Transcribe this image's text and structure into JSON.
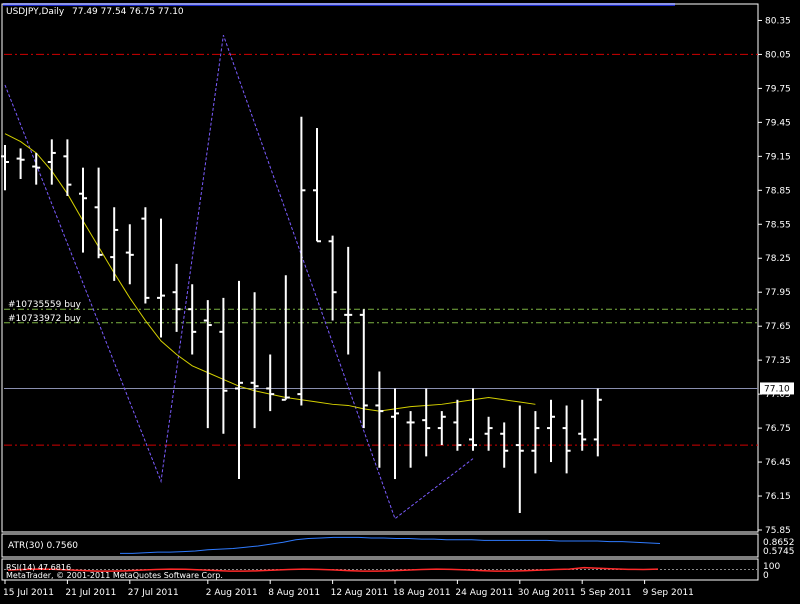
{
  "chart_data": {
    "type": "ohlc",
    "header": {
      "symbol_tf": "USDJPY,Daily",
      "ohlc_text": "77.49 77.54 76.75 77.10"
    },
    "price_axis": {
      "min": 75.85,
      "max": 80.46,
      "ticks": [
        "80.35",
        "80.05",
        "79.75",
        "79.45",
        "79.15",
        "78.85",
        "78.55",
        "78.25",
        "77.95",
        "77.65",
        "77.35",
        "77.05",
        "76.75",
        "76.45",
        "76.15",
        "75.85"
      ],
      "current_price": "77.10",
      "grid": false
    },
    "date_ticks": [
      {
        "label": "15 Jul 2011",
        "index": 0
      },
      {
        "label": "21 Jul 2011",
        "index": 4
      },
      {
        "label": "27 Jul 2011",
        "index": 8
      },
      {
        "label": "2 Aug 2011",
        "index": 13
      },
      {
        "label": "8 Aug 2011",
        "index": 17
      },
      {
        "label": "12 Aug 2011",
        "index": 21
      },
      {
        "label": "18 Aug 2011",
        "index": 25
      },
      {
        "label": "24 Aug 2011",
        "index": 29
      },
      {
        "label": "30 Aug 2011",
        "index": 33
      },
      {
        "label": "5 Sep 2011",
        "index": 37
      },
      {
        "label": "9 Sep 2011",
        "index": 41
      }
    ],
    "bars": [
      {
        "o": 79.15,
        "h": 79.25,
        "l": 78.85,
        "c": 79.1
      },
      {
        "o": 79.13,
        "h": 79.22,
        "l": 78.95,
        "c": 79.12
      },
      {
        "o": 79.06,
        "h": 79.18,
        "l": 78.9,
        "c": 79.05
      },
      {
        "o": 79.1,
        "h": 79.3,
        "l": 78.9,
        "c": 79.18
      },
      {
        "o": 79.15,
        "h": 79.3,
        "l": 78.8,
        "c": 78.9
      },
      {
        "o": 78.82,
        "h": 79.05,
        "l": 78.3,
        "c": 78.78
      },
      {
        "o": 78.7,
        "h": 79.05,
        "l": 78.25,
        "c": 78.28
      },
      {
        "o": 78.26,
        "h": 78.7,
        "l": 78.05,
        "c": 78.5
      },
      {
        "o": 78.3,
        "h": 78.55,
        "l": 78.02,
        "c": 78.28
      },
      {
        "o": 78.6,
        "h": 78.7,
        "l": 77.85,
        "c": 77.9
      },
      {
        "o": 77.9,
        "h": 78.6,
        "l": 77.55,
        "c": 77.92
      },
      {
        "o": 77.95,
        "h": 78.2,
        "l": 77.6,
        "c": 77.8
      },
      {
        "o": 77.8,
        "h": 78.02,
        "l": 77.4,
        "c": 77.6
      },
      {
        "o": 77.7,
        "h": 77.88,
        "l": 76.75,
        "c": 77.66
      },
      {
        "o": 77.6,
        "h": 77.9,
        "l": 76.7,
        "c": 77.08
      },
      {
        "o": 77.1,
        "h": 78.05,
        "l": 76.3,
        "c": 77.15
      },
      {
        "o": 77.15,
        "h": 77.95,
        "l": 76.75,
        "c": 77.12
      },
      {
        "o": 77.1,
        "h": 77.4,
        "l": 76.9,
        "c": 77.05
      },
      {
        "o": 77.0,
        "h": 78.1,
        "l": 77.0,
        "c": 77.02
      },
      {
        "o": 77.05,
        "h": 79.5,
        "l": 76.95,
        "c": 78.85
      },
      {
        "o": 78.85,
        "h": 79.4,
        "l": 78.4,
        "c": 78.4
      },
      {
        "o": 78.4,
        "h": 78.45,
        "l": 77.7,
        "c": 77.95
      },
      {
        "o": 77.75,
        "h": 78.35,
        "l": 77.4,
        "c": 77.75
      },
      {
        "o": 77.75,
        "h": 77.8,
        "l": 76.75,
        "c": 76.95
      },
      {
        "o": 76.95,
        "h": 77.25,
        "l": 76.4,
        "c": 76.9
      },
      {
        "o": 76.85,
        "h": 77.1,
        "l": 76.3,
        "c": 76.88
      },
      {
        "o": 76.8,
        "h": 76.9,
        "l": 76.4,
        "c": 76.8
      },
      {
        "o": 76.82,
        "h": 77.1,
        "l": 76.5,
        "c": 76.75
      },
      {
        "o": 76.75,
        "h": 76.9,
        "l": 76.6,
        "c": 76.85
      },
      {
        "o": 76.8,
        "h": 77.0,
        "l": 76.55,
        "c": 76.6
      },
      {
        "o": 76.65,
        "h": 77.1,
        "l": 76.55,
        "c": 76.6
      },
      {
        "o": 76.7,
        "h": 76.85,
        "l": 76.55,
        "c": 76.75
      },
      {
        "o": 76.7,
        "h": 76.8,
        "l": 76.4,
        "c": 76.55
      },
      {
        "o": 76.6,
        "h": 76.95,
        "l": 76.0,
        "c": 76.55
      },
      {
        "o": 76.55,
        "h": 76.9,
        "l": 76.35,
        "c": 76.75
      },
      {
        "o": 76.75,
        "h": 77.0,
        "l": 76.45,
        "c": 76.85
      },
      {
        "o": 76.75,
        "h": 76.95,
        "l": 76.35,
        "c": 76.55
      },
      {
        "o": 76.7,
        "h": 77.0,
        "l": 76.55,
        "c": 76.65
      },
      {
        "o": 76.65,
        "h": 77.1,
        "l": 76.5,
        "c": 77.0
      }
    ],
    "ma_points": [
      79.35,
      79.28,
      79.18,
      79.02,
      78.82,
      78.58,
      78.35,
      78.12,
      77.9,
      77.7,
      77.52,
      77.4,
      77.3,
      77.24,
      77.18,
      77.12,
      77.08,
      77.05,
      77.02,
      77.0,
      76.98,
      76.96,
      76.95,
      76.92,
      76.9,
      76.92,
      76.94,
      76.95,
      76.96,
      76.98,
      77.0,
      77.02,
      77.0,
      76.98,
      76.96
    ],
    "zigzag": [
      {
        "i": 0,
        "p": 79.78
      },
      {
        "i": 10,
        "p": 76.28
      },
      {
        "i": 14,
        "p": 80.22
      },
      {
        "i": 25,
        "p": 75.95
      },
      {
        "i": 30,
        "p": 76.48
      }
    ],
    "horizontal_lines": [
      {
        "price": 80.05,
        "style": "red-dashdot"
      },
      {
        "price": 76.6,
        "style": "red-dashdot"
      },
      {
        "price": 77.8,
        "style": "green-dashed",
        "label": "#10735559 buy"
      },
      {
        "price": 77.68,
        "style": "green-dashed",
        "label": "#10733972 buy"
      },
      {
        "price": 77.1,
        "style": "current"
      }
    ],
    "atr_panel": {
      "label": "ATR(30) 0.7560",
      "tick_high": "0.8652",
      "tick_low": "0.5745",
      "min": 0.5745,
      "max": 0.8652,
      "values": [
        0.6,
        0.6,
        0.61,
        0.62,
        0.62,
        0.63,
        0.64,
        0.66,
        0.67,
        0.68,
        0.7,
        0.72,
        0.75,
        0.78,
        0.82,
        0.84,
        0.85,
        0.86,
        0.86,
        0.86,
        0.85,
        0.85,
        0.84,
        0.84,
        0.83,
        0.83,
        0.82,
        0.82,
        0.82,
        0.81,
        0.81,
        0.81,
        0.81,
        0.81,
        0.81,
        0.8,
        0.8,
        0.8,
        0.8,
        0.79,
        0.79,
        0.78,
        0.77,
        0.76
      ]
    },
    "rsi_panel": {
      "label": "RSI(14) 47.6816",
      "tick_high": "100",
      "tick_low": "0",
      "ref_line": 50
    },
    "copyright": "MetaTrader, © 2001-2011 MetaQuotes Software Corp.",
    "colors": {
      "background": "#000000",
      "bars": "#ffffff",
      "ma": "#d4d000",
      "zigzag": "#7b5cff",
      "red_lines": "#d10000",
      "green_lines": "#7cb342",
      "current_line": "#8a8fb0",
      "atr": "#2f7bff",
      "rsi": "#ff2a2a",
      "axis": "#ffffff",
      "top_strip": "#1a28c8"
    }
  }
}
